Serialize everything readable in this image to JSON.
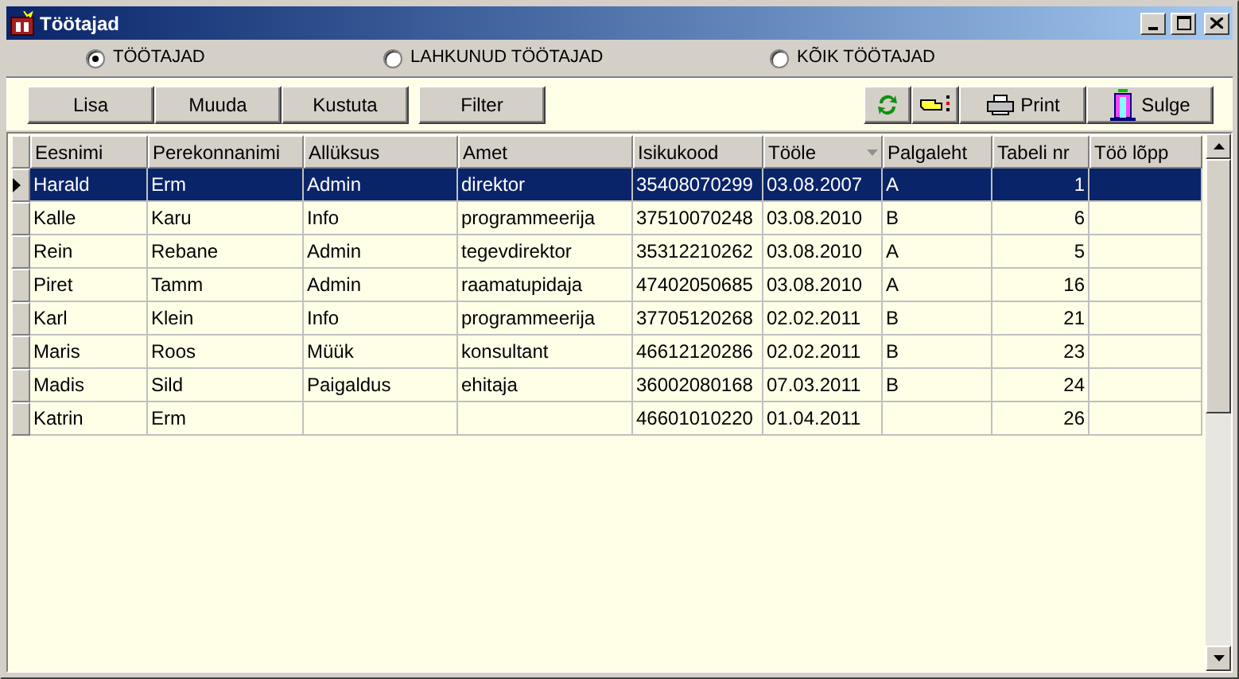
{
  "window": {
    "title": "Töötajad"
  },
  "filters": [
    {
      "label": "TÖÖTAJAD",
      "selected": true
    },
    {
      "label": "LAHKUNUD TÖÖTAJAD",
      "selected": false
    },
    {
      "label": "KÕIK TÖÖTAJAD",
      "selected": false
    }
  ],
  "left_buttons": [
    "Lisa",
    "Muuda",
    "Kustuta",
    "Filter"
  ],
  "right_buttons": [
    {
      "kind": "refresh"
    },
    {
      "kind": "pointer"
    },
    {
      "kind": "print",
      "label": "Print"
    },
    {
      "kind": "close",
      "label": "Sulge"
    }
  ],
  "table": {
    "columns": [
      {
        "label": "Eesnimi",
        "kind": "text",
        "sorted": false
      },
      {
        "label": "Perekonnanimi",
        "kind": "text",
        "sorted": false
      },
      {
        "label": "Allüksus",
        "kind": "text",
        "sorted": false
      },
      {
        "label": "Amet",
        "kind": "text",
        "sorted": false
      },
      {
        "label": "Isikukood",
        "kind": "text",
        "sorted": false
      },
      {
        "label": "Tööle",
        "kind": "text",
        "sorted": true
      },
      {
        "label": "Palgaleht",
        "kind": "text",
        "sorted": false
      },
      {
        "label": "Tabeli nr",
        "kind": "number",
        "sorted": false
      },
      {
        "label": "Töö lõpp",
        "kind": "text",
        "sorted": false
      }
    ],
    "rows": [
      {
        "selected": true,
        "cells": [
          "Harald",
          "Erm",
          "Admin",
          "direktor",
          "35408070299",
          "03.08.2007",
          "A",
          "1",
          ""
        ]
      },
      {
        "selected": false,
        "cells": [
          "Kalle",
          "Karu",
          "Info",
          "programmeerija",
          "37510070248",
          "03.08.2010",
          "B",
          "6",
          ""
        ]
      },
      {
        "selected": false,
        "cells": [
          "Rein",
          "Rebane",
          "Admin",
          "tegevdirektor",
          "35312210262",
          "03.08.2010",
          "A",
          "5",
          ""
        ]
      },
      {
        "selected": false,
        "cells": [
          "Piret",
          "Tamm",
          "Admin",
          "raamatupidaja",
          "47402050685",
          "03.08.2010",
          "A",
          "16",
          ""
        ]
      },
      {
        "selected": false,
        "cells": [
          "Karl",
          "Klein",
          "Info",
          "programmeerija",
          "37705120268",
          "02.02.2011",
          "B",
          "21",
          ""
        ]
      },
      {
        "selected": false,
        "cells": [
          "Maris",
          "Roos",
          "Müük",
          "konsultant",
          "46612120286",
          "02.02.2011",
          "B",
          "23",
          ""
        ]
      },
      {
        "selected": false,
        "cells": [
          "Madis",
          "Sild",
          "Paigaldus",
          "ehitaja",
          "36002080168",
          "07.03.2011",
          "B",
          "24",
          ""
        ]
      },
      {
        "selected": false,
        "cells": [
          "Katrin",
          "Erm",
          "",
          "",
          "46601010220",
          "01.04.2011",
          "",
          "26",
          ""
        ]
      }
    ]
  }
}
